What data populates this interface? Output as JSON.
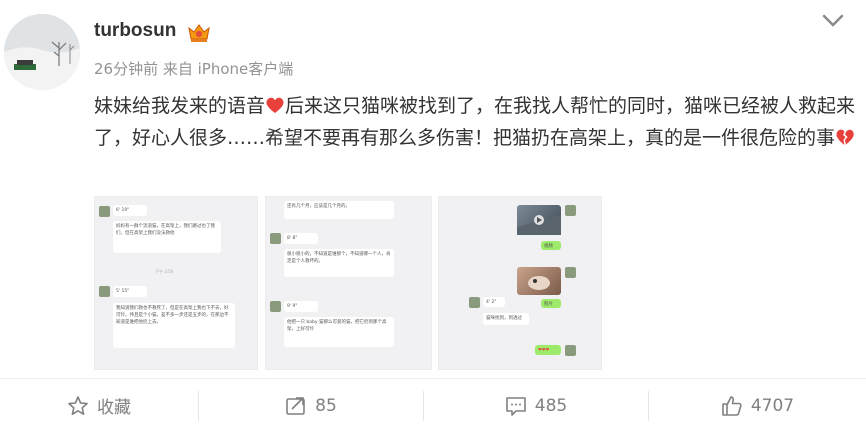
{
  "user": {
    "name": "turbosun",
    "vip_icon": "crown-vip-icon"
  },
  "post": {
    "time": "26分钟前",
    "source": "来自 iPhone客户端",
    "text_part1": "妹妹给我发来的语音",
    "text_part2": "后来这只猫咪被找到了，在我找人帮忙的同时，猫咪已经被人救起来了，好心人很多……希望不要再有那么多伤害！把猫扔在高架上，真的是一件很危险的事"
  },
  "images": [
    {
      "messages": [
        {
          "side": "left",
          "text": "6' 19\""
        },
        {
          "side": "left",
          "text": "妈妈有一群个流浪猫，在高架上，我们路过也了我们，但在高架上我们没法救他"
        },
        {
          "side": "time",
          "text": "下午 3:50"
        },
        {
          "side": "left",
          "text": "5' 15\""
        },
        {
          "side": "left",
          "text": "我知道我们救也不救死了，但是在高架上我也下不去，好可怜。伟且是个小猫，差不多一步还是五步的，在那边不知道是谁把他扔上去。"
        }
      ]
    },
    {
      "messages": [
        {
          "side": "left",
          "text": "还有几个月，应该是几个月的。"
        },
        {
          "side": "left",
          "text": "8' 8\""
        },
        {
          "side": "left",
          "text": "很小很小的，不知道是谁那个，不知道哪一个人，肯定是个人救坏的。"
        },
        {
          "side": "left",
          "text": "9' 9\""
        },
        {
          "side": "left",
          "text": "他把一只 baby 猫那么可爱的猫，把它扔到那个高架，上好可怜"
        }
      ]
    },
    {
      "messages": [
        {
          "side": "right",
          "text": "视频"
        },
        {
          "side": "right",
          "text": "照片"
        },
        {
          "side": "left",
          "text": "4' 2\""
        },
        {
          "side": "left",
          "text": "猫咪找到，到透过"
        },
        {
          "side": "right",
          "text": "❤❤❤"
        }
      ]
    }
  ],
  "actions": {
    "favorite": {
      "label": "收藏",
      "icon": "star-icon"
    },
    "repost": {
      "count": "85",
      "icon": "repost-icon"
    },
    "comment": {
      "count": "485",
      "icon": "comment-icon"
    },
    "like": {
      "count": "4707",
      "icon": "thumbs-up-icon"
    }
  },
  "colors": {
    "heart": "#e8403a",
    "vip": "#f39c12",
    "chat_green": "#9eea6a"
  }
}
